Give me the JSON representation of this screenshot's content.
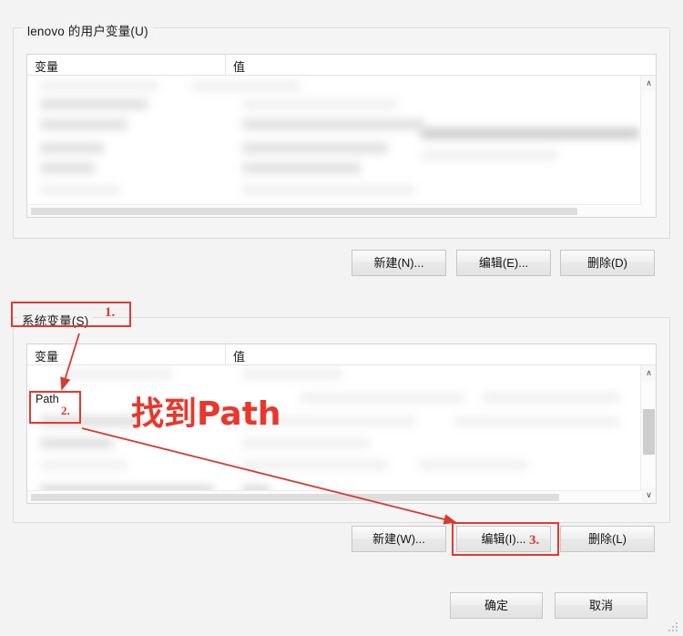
{
  "dialog": {
    "user_group_label": "lenovo 的用户变量(U)",
    "system_group_label": "系统变量(S)",
    "ok_label": "确定",
    "cancel_label": "取消"
  },
  "table": {
    "col_variable": "变量",
    "col_value": "值"
  },
  "user_variables": {
    "buttons": {
      "new": "新建(N)...",
      "edit": "编辑(E)...",
      "delete": "删除(D)"
    }
  },
  "system_variables": {
    "highlighted_row": "Path",
    "buttons": {
      "new": "新建(W)...",
      "edit": "编辑(I)...",
      "delete": "删除(L)"
    }
  },
  "annotations": {
    "step1": "1.",
    "step2": "2.",
    "step3": "3.",
    "callout_text": "找到Path",
    "color": "#e4392f"
  },
  "icons": {
    "scroll_up": "∧",
    "scroll_down": "∨"
  }
}
